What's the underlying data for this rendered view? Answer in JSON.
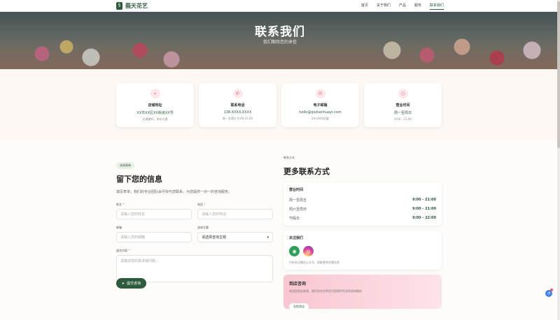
{
  "nav": {
    "brand_glyph": "§",
    "brand": "莪天花艺",
    "links": [
      "首页",
      "关于我们",
      "产品",
      "服务",
      "联系我们"
    ]
  },
  "hero": {
    "title": "联系我们",
    "subtitle": "我们期待您的来信"
  },
  "cards": [
    {
      "icon": "location-pin-icon",
      "glyph": "⌖",
      "title": "店铺地址",
      "line1": "XX市XX区XX街道XX号",
      "line2": "交通便利，停车方便"
    },
    {
      "icon": "phone-icon",
      "glyph": "✆",
      "title": "联系电话",
      "line1": "138-XXXX-XXXX",
      "line2": "周一至周日 9:00-21:00"
    },
    {
      "icon": "mail-icon",
      "glyph": "✉",
      "title": "电子邮箱",
      "line1": "hello@qiutianhuayi.com",
      "line2": "24小时内回复"
    },
    {
      "icon": "clock-icon",
      "glyph": "◷",
      "title": "营业时间",
      "line1": "周一至周日",
      "line2": "9:00 - 21:00"
    }
  ],
  "form": {
    "pill": "咨询表单",
    "title": "留下您的信息",
    "desc": "填写表单，我们的专业团队会尽快与您联系，为您提供一对一的咨询服务。",
    "name_label": "姓名",
    "name_placeholder": "请输入您的姓名",
    "phone_label": "电话",
    "phone_placeholder": "请输入您的电话",
    "email_label": "邮箱",
    "email_placeholder": "请输入您的邮箱",
    "topic_label": "咨询主题",
    "topic_value": "请选择咨询主题",
    "message_label": "留言内容",
    "message_placeholder": "请描述您的需求或问题...",
    "required_mark": "*",
    "submit_glyph": "➤",
    "submit": "提交咨询",
    "select_glyph": "▾"
  },
  "right": {
    "kicker": "联系方式",
    "title": "更多联系方式",
    "hours_title": "营业时间",
    "hours": [
      {
        "day": "周一至周五",
        "time": "9:00 - 21:00"
      },
      {
        "day": "周六至周日",
        "time": "9:00 - 21:00"
      },
      {
        "day": "节假日",
        "time": "9:00 - 22:00"
      }
    ],
    "social_title": "关注我们",
    "wechat_glyph": "◉",
    "insta_glyph": "◎",
    "social_note": "扫码关注微信公众号，获取更多优惠信息",
    "visit_title": "到店咨询",
    "visit_desc": "欢迎您到店参观，我们的花艺师会为您提供专业的咨询服务",
    "visit_button": "导航到店"
  },
  "float": {
    "glyph": "◔"
  }
}
